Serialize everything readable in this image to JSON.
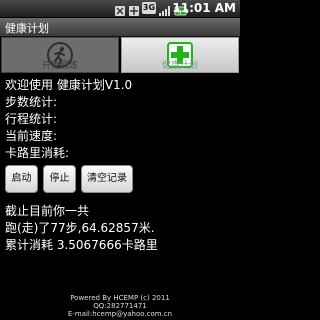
{
  "status_bar": {
    "time": "11:01 AM",
    "signal_label": "3G",
    "icons": [
      "usb-icon",
      "notification-icon",
      "3g-icon",
      "signal-icon",
      "battery-icon"
    ]
  },
  "app": {
    "title": "健康计划"
  },
  "tabs": [
    {
      "label": "开始锻炼",
      "icon": "running-person-icon",
      "selected": false
    },
    {
      "label": "健康计划",
      "icon": "medical-cross-icon",
      "selected": true
    }
  ],
  "main": {
    "welcome": "欢迎使用 健康计划V1.0",
    "stats": {
      "steps_label": "步数统计:",
      "distance_label": "行程统计:",
      "speed_label": "当前速度:",
      "calories_label": "卡路里消耗:"
    },
    "buttons": {
      "start": "启动",
      "stop": "停止",
      "clear": "清空记录"
    },
    "summary": {
      "line1": "截止目前你一共",
      "line2": "跑(走)了77步,64.62857米.",
      "line3": "累计消耗 3.5067666卡路里"
    }
  },
  "footer": {
    "powered_by": "Powered By HCEMP (c) 2011",
    "qq": "QQ:282771471",
    "email": "E-mail:hcemp@yahoo.com.cn"
  },
  "colors": {
    "cross_green": "#1db41d",
    "background": "#000000"
  }
}
